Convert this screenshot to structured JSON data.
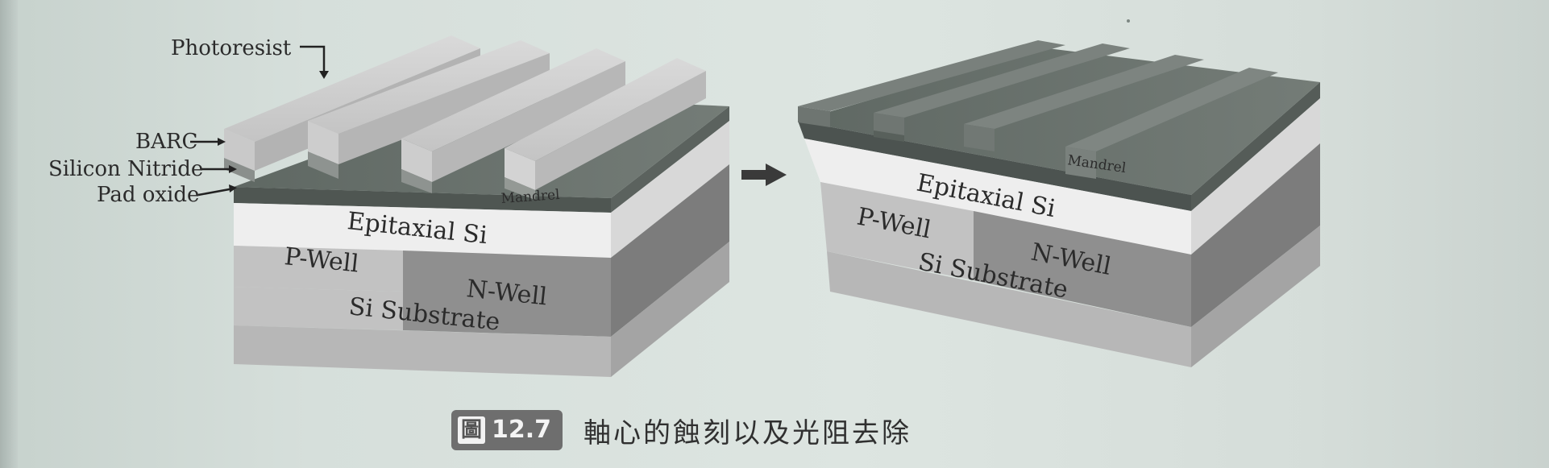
{
  "left_diagram": {
    "labels": {
      "photoresist": "Photoresist",
      "barc": "BARC",
      "silicon_nitride": "Silicon Nitride",
      "pad_oxide": "Pad oxide",
      "mandrel": "Mandrel",
      "epitaxial": "Epitaxial Si",
      "pwell": "P-Well",
      "nwell": "N-Well",
      "substrate": "Si Substrate"
    }
  },
  "right_diagram": {
    "labels": {
      "mandrel": "Mandrel",
      "epitaxial": "Epitaxial Si",
      "pwell": "P-Well",
      "nwell": "N-Well",
      "substrate": "Si Substrate"
    }
  },
  "caption": {
    "figure_prefix": "圖",
    "figure_number": "12.7",
    "text": "軸心的蝕刻以及光阻去除"
  },
  "colors": {
    "photoresist_top": "#cfcfcf",
    "photoresist_side": "#b9b9b9",
    "nitride_top": "#6b736e",
    "epitaxial_face": "#ececec",
    "pwell_face": "#bdbdbd",
    "nwell_face": "#8b8b8b",
    "substrate_face": "#b3b3b3",
    "arrow": "#3a3a3a"
  }
}
